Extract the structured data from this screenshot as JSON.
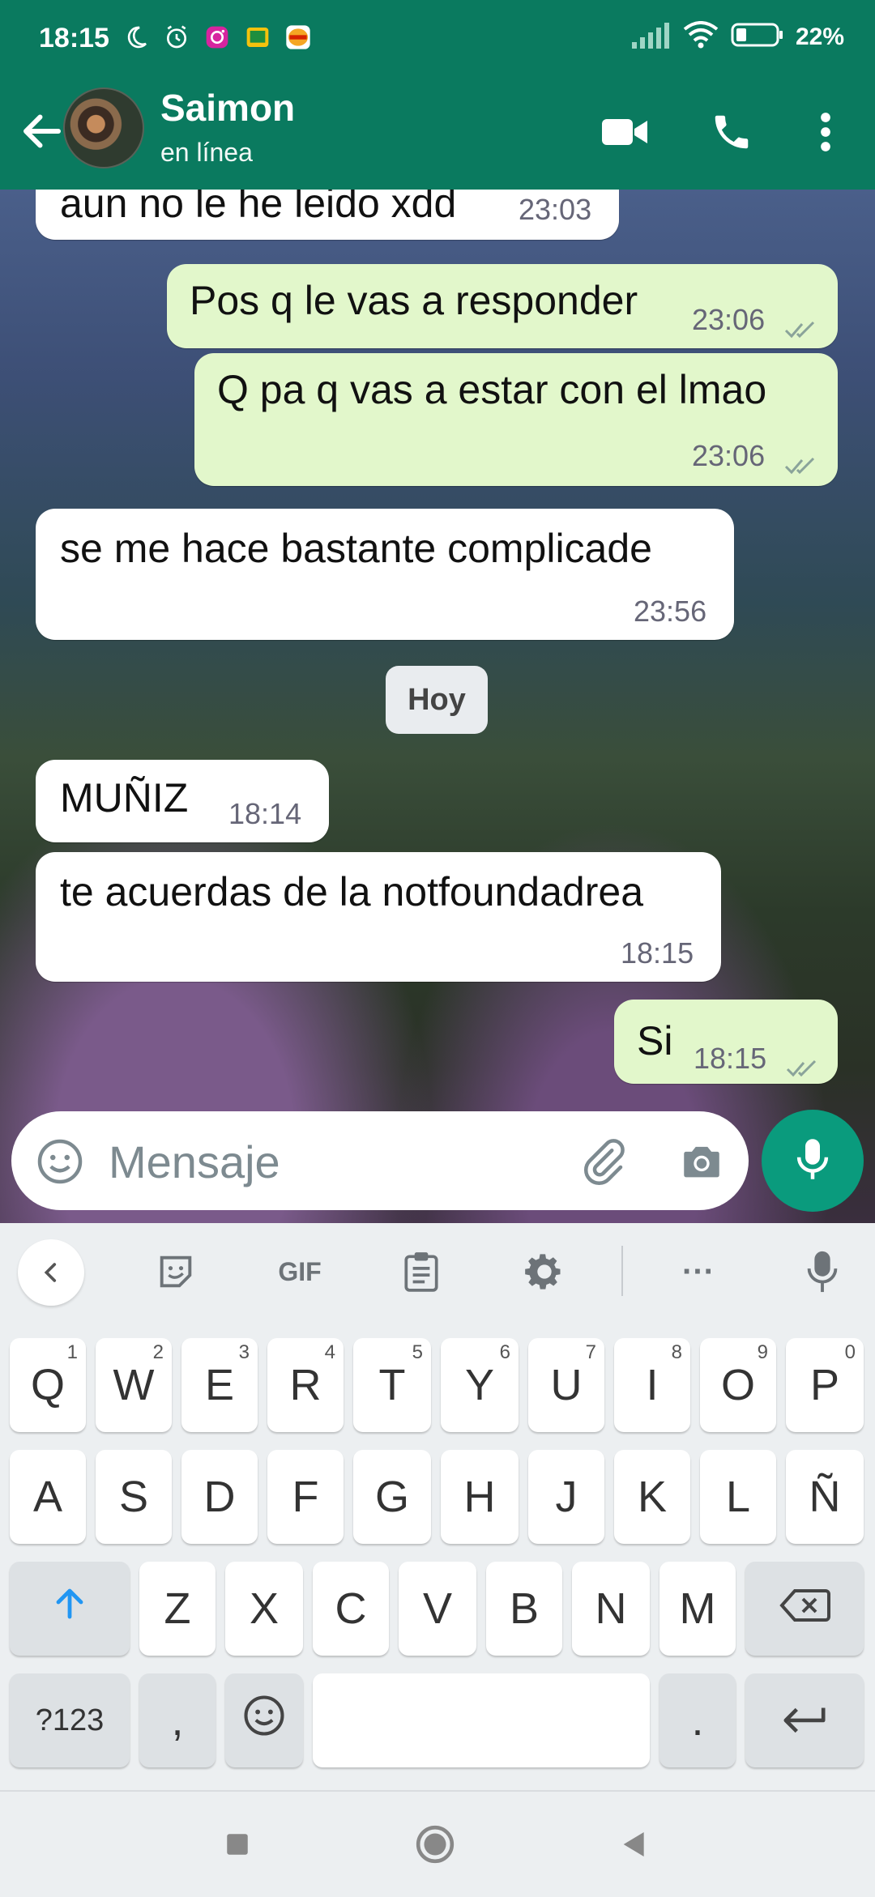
{
  "status_bar": {
    "time": "18:15",
    "battery": "22%"
  },
  "header": {
    "contact_name": "Saimon",
    "contact_status": "en línea"
  },
  "messages": [
    {
      "dir": "in",
      "text": "aun no le he leido xdd",
      "time": "23:03"
    },
    {
      "dir": "out",
      "text": "Pos q le vas a responder",
      "time": "23:06"
    },
    {
      "dir": "out",
      "text": "Q pa q vas a estar con el lmao",
      "time": "23:06"
    },
    {
      "dir": "in",
      "text": "se me hace bastante complicade",
      "time": "23:56"
    },
    {
      "dir": "in",
      "text": "MUÑIZ",
      "time": "18:14"
    },
    {
      "dir": "in",
      "text": "te acuerdas de la notfoundadrea",
      "time": "18:15"
    },
    {
      "dir": "out",
      "text": "Si",
      "time": "18:15"
    }
  ],
  "day_separator": "Hoy",
  "composer": {
    "placeholder": "Mensaje"
  },
  "keyboard_toolbar": {
    "gif_label": "GIF",
    "more_label": "···"
  },
  "keyboard": {
    "row1": [
      {
        "key": "Q",
        "hint": "1"
      },
      {
        "key": "W",
        "hint": "2"
      },
      {
        "key": "E",
        "hint": "3"
      },
      {
        "key": "R",
        "hint": "4"
      },
      {
        "key": "T",
        "hint": "5"
      },
      {
        "key": "Y",
        "hint": "6"
      },
      {
        "key": "U",
        "hint": "7"
      },
      {
        "key": "I",
        "hint": "8"
      },
      {
        "key": "O",
        "hint": "9"
      },
      {
        "key": "P",
        "hint": "0"
      }
    ],
    "row2": [
      "A",
      "S",
      "D",
      "F",
      "G",
      "H",
      "J",
      "K",
      "L",
      "Ñ"
    ],
    "row3": [
      "Z",
      "X",
      "C",
      "V",
      "B",
      "N",
      "M"
    ],
    "symbols_key": "?123",
    "comma_key": ",",
    "period_key": "."
  },
  "colors": {
    "header": "#0a7a5f",
    "outgoing_bubble": "#e2f7cb",
    "incoming_bubble": "#ffffff",
    "accent": "#0a9b7d"
  }
}
